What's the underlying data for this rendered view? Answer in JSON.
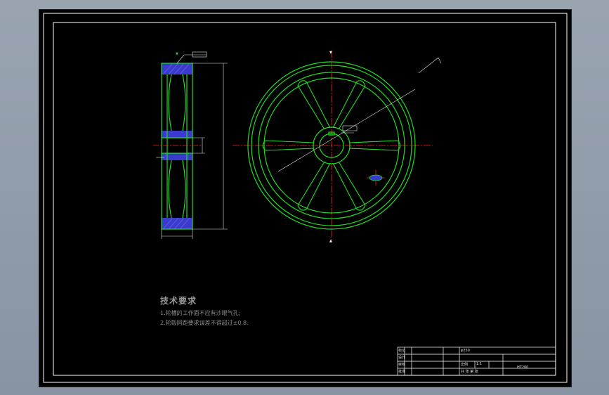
{
  "drawing": {
    "background": "#000000",
    "frame_color": "#ffffff",
    "outline_color": "#22dd22",
    "centerline_color": "#ff2020",
    "dimension_color": "#e8e8e8",
    "hatch_color": "#3a3acc"
  },
  "tech_requirements": {
    "title": "技术要求",
    "items": [
      "1.轮槽的工作面不应有沙眼气孔;",
      "2.轮毂同距要求误差不得超过±0.8."
    ]
  },
  "title_block": {
    "cells": [
      "标记",
      "设计",
      "审核",
      "批准",
      "φ250",
      "比例",
      "1:1",
      "共  张  第  张",
      "HT200"
    ]
  }
}
